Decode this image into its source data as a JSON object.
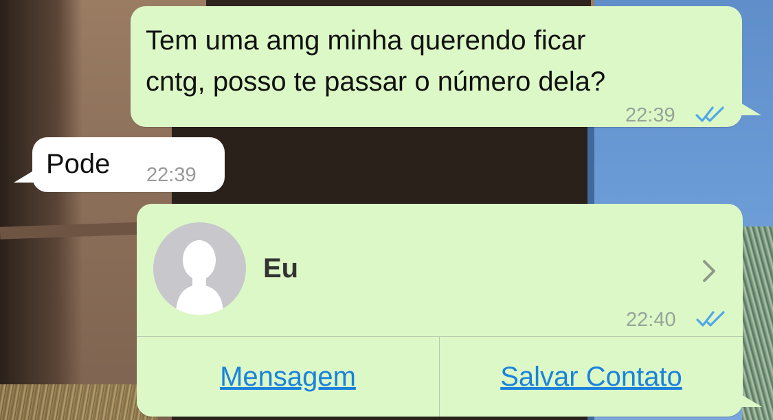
{
  "messages": [
    {
      "direction": "outgoing",
      "text": "Tem uma amg minha querendo ficar\ncntg, posso te passar o número dela?",
      "time": "22:39",
      "status": "read-double-check"
    },
    {
      "direction": "incoming",
      "text": "Pode",
      "time": "22:39"
    }
  ],
  "contact_card": {
    "direction": "outgoing",
    "name": "Eu",
    "avatar_icon": "default-avatar-icon",
    "time": "22:40",
    "status": "read-double-check",
    "actions": {
      "message_label": "Mensagem",
      "save_label": "Salvar Contato"
    }
  },
  "colors": {
    "outgoing_bubble": "#dcf8c6",
    "incoming_bubble": "#ffffff",
    "read_ticks": "#4fa6ea",
    "link": "#1a82dc",
    "avatar_bg": "#c8c7cc"
  }
}
